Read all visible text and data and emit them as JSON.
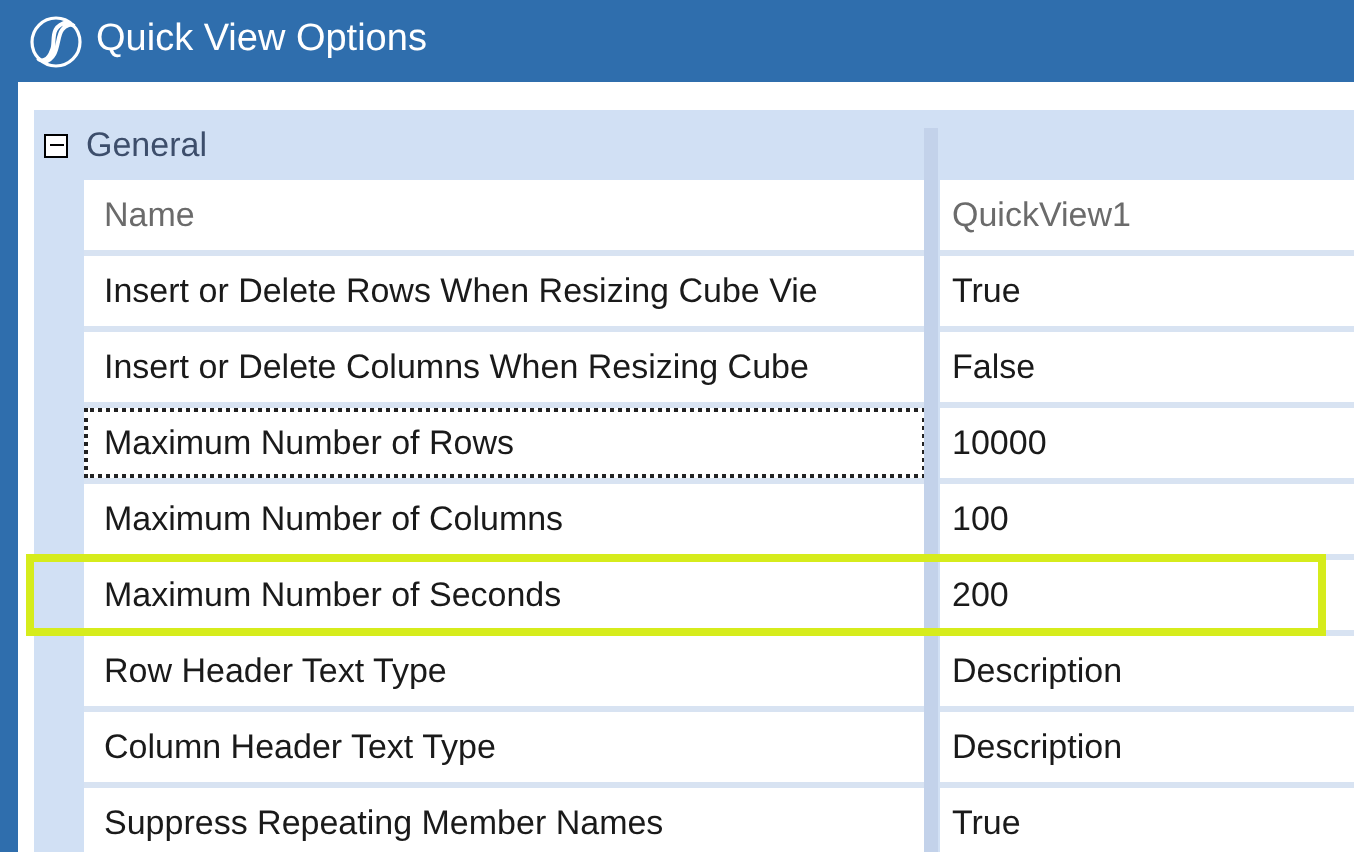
{
  "window": {
    "title": "Quick View Options"
  },
  "group": {
    "label": "General",
    "expanded": true
  },
  "header": {
    "name": "Name",
    "value": "QuickView1"
  },
  "rows": [
    {
      "name": "Insert or Delete Rows When Resizing Cube Vie",
      "value": "True",
      "focused": false
    },
    {
      "name": "Insert or Delete Columns When Resizing Cube",
      "value": "False",
      "focused": false
    },
    {
      "name": "Maximum Number of Rows",
      "value": "10000",
      "focused": true
    },
    {
      "name": "Maximum Number of Columns",
      "value": "100",
      "focused": false
    },
    {
      "name": "Maximum Number of Seconds",
      "value": "200",
      "focused": false,
      "highlighted": true
    },
    {
      "name": "Row Header Text Type",
      "value": "Description",
      "focused": false
    },
    {
      "name": "Column Header Text Type",
      "value": "Description",
      "focused": false
    },
    {
      "name": "Suppress Repeating Member Names",
      "value": "True",
      "focused": false
    }
  ]
}
